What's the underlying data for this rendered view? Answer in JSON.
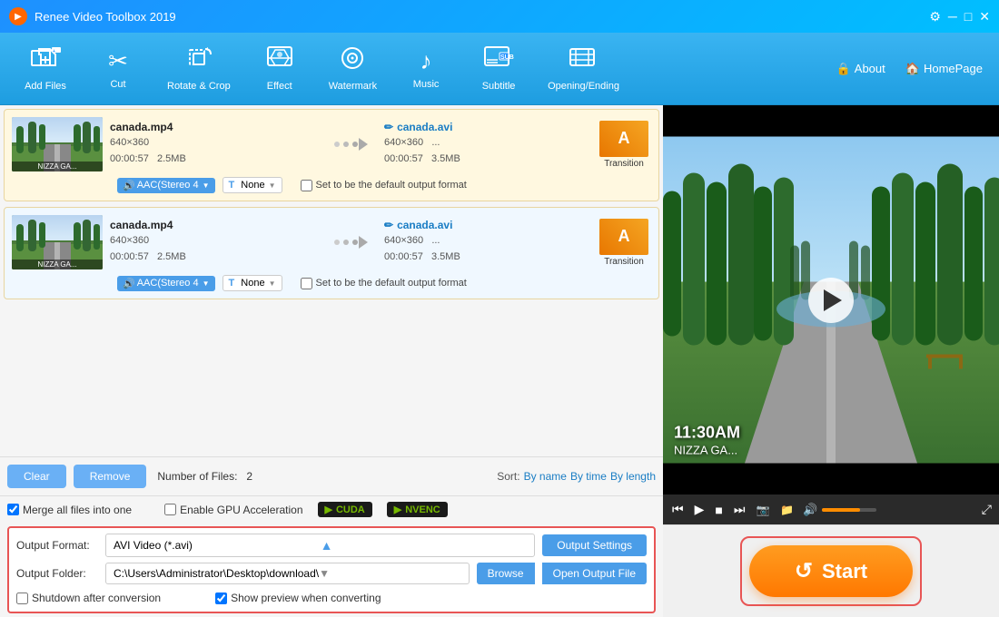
{
  "app": {
    "title": "Renee Video Toolbox 2019",
    "icon": "🎬"
  },
  "window_controls": {
    "minimize": "─",
    "maximize": "□",
    "close": "✕"
  },
  "toolbar": {
    "items": [
      {
        "id": "add-files",
        "icon": "🎬",
        "label": "Add Files"
      },
      {
        "id": "cut",
        "icon": "✂",
        "label": "Cut"
      },
      {
        "id": "rotate-crop",
        "icon": "⊡",
        "label": "Rotate & Crop"
      },
      {
        "id": "effect",
        "icon": "🎆",
        "label": "Effect"
      },
      {
        "id": "watermark",
        "icon": "⊙",
        "label": "Watermark"
      },
      {
        "id": "music",
        "icon": "♪",
        "label": "Music"
      },
      {
        "id": "subtitle",
        "icon": "SUB",
        "label": "Subtitle"
      },
      {
        "id": "opening-ending",
        "icon": "▤",
        "label": "Opening/Ending"
      }
    ],
    "about": "About",
    "homepage": "HomePage"
  },
  "file_items": [
    {
      "id": "file1",
      "input": {
        "filename": "canada.mp4",
        "resolution": "640×360",
        "duration": "00:00:57",
        "size": "2.5MB"
      },
      "output": {
        "filename": "canada.avi",
        "resolution": "640×360",
        "duration": "00:00:57",
        "size": "3.5MB",
        "dots": "..."
      },
      "transition": {
        "label": "Transition",
        "icon": "A"
      },
      "audio": "AAC(Stereo 4",
      "format": "None",
      "default_label": "Set to be the default output format"
    },
    {
      "id": "file2",
      "input": {
        "filename": "canada.mp4",
        "resolution": "640×360",
        "duration": "00:00:57",
        "size": "2.5MB"
      },
      "output": {
        "filename": "canada.avi",
        "resolution": "640×360",
        "duration": "00:00:57",
        "size": "3.5MB",
        "dots": "..."
      },
      "transition": {
        "label": "Transition",
        "icon": "A"
      },
      "audio": "AAC(Stereo 4",
      "format": "None",
      "default_label": "Set to be the default output format"
    }
  ],
  "action_bar": {
    "clear": "Clear",
    "remove": "Remove",
    "file_count_label": "Number of Files:",
    "file_count": "2",
    "sort_label": "Sort:",
    "sort_options": [
      "By name",
      "By time",
      "By length"
    ]
  },
  "options": {
    "merge_label": "Merge all files into one",
    "gpu_label": "Enable GPU Acceleration",
    "cuda_label": "CUDA",
    "nvenc_label": "NVENC"
  },
  "output_section": {
    "format_label": "Output Format:",
    "format_value": "AVI Video (*.avi)",
    "output_settings": "Output Settings",
    "folder_label": "Output Folder:",
    "folder_value": "C:\\Users\\Administrator\\Desktop\\download\\",
    "browse": "Browse",
    "open_output": "Open Output File",
    "shutdown_label": "Shutdown after conversion",
    "preview_label": "Show preview when converting"
  },
  "player": {
    "time_display": "11:30AM",
    "location": "NIZZA GA...",
    "controls": {
      "rewind": "⏮",
      "play": "▶",
      "stop": "■",
      "forward": "⏭",
      "screenshot": "📷",
      "folder": "📁",
      "volume": "🔊",
      "fullscreen": "⤢"
    }
  },
  "start_button": {
    "label": "Start",
    "icon": "↺"
  }
}
